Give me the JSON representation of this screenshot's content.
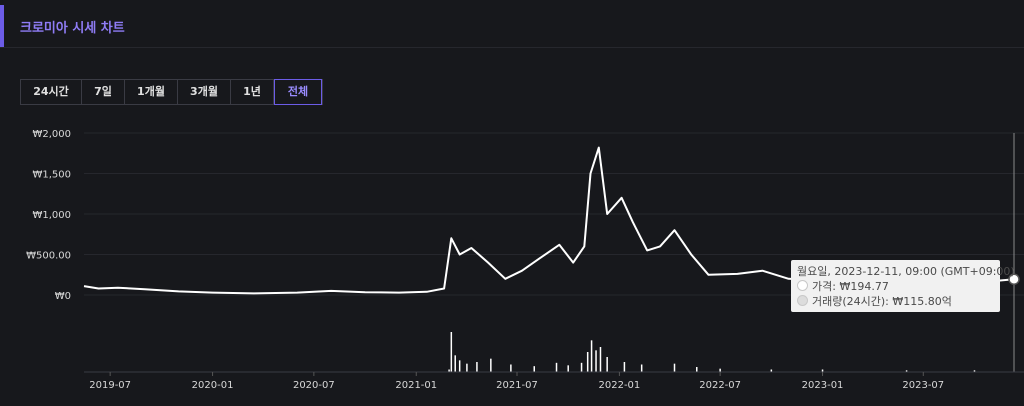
{
  "header": {
    "title": "크로미아 시세 차트"
  },
  "range_tabs": [
    {
      "label": "24시간",
      "active": false
    },
    {
      "label": "7일",
      "active": false
    },
    {
      "label": "1개월",
      "active": false
    },
    {
      "label": "3개월",
      "active": false
    },
    {
      "label": "1년",
      "active": false
    },
    {
      "label": "전체",
      "active": true
    }
  ],
  "tooltip": {
    "date": "월요일, 2023-12-11, 09:00 (GMT+09:00)",
    "price_label": "가격:",
    "price_value": "₩194.77",
    "volume_label": "거래량(24시간):",
    "volume_value": "₩115.80억"
  },
  "colors": {
    "accent": "#6c5ce7",
    "line": "#ffffff",
    "background": "#17181c"
  },
  "chart_data": {
    "type": "line",
    "title": "",
    "xlabel": "",
    "ylabel": "",
    "y_tick_labels": [
      "₩0",
      "₩500.00",
      "₩1,000",
      "₩1,500",
      "₩2,000"
    ],
    "y_tick_values": [
      0,
      500,
      1000,
      1500,
      2000
    ],
    "ylim": [
      0,
      2000
    ],
    "x_tick_labels": [
      "2019-07",
      "2020-01",
      "2020-07",
      "2021-01",
      "2021-07",
      "2022-01",
      "2022-07",
      "2023-01",
      "2023-07"
    ],
    "xlim": [
      "2019-05-15",
      "2023-12-11"
    ],
    "grid": "horizontal",
    "series": [
      {
        "values": [
          [
            "2019-05-15",
            110
          ],
          [
            "2019-06-10",
            80
          ],
          [
            "2019-07-15",
            90
          ],
          [
            "2019-09-01",
            70
          ],
          [
            "2019-11-01",
            45
          ],
          [
            "2020-01-01",
            30
          ],
          [
            "2020-03-15",
            20
          ],
          [
            "2020-06-01",
            30
          ],
          [
            "2020-08-01",
            50
          ],
          [
            "2020-10-01",
            35
          ],
          [
            "2020-12-01",
            30
          ],
          [
            "2021-01-20",
            40
          ],
          [
            "2021-02-20",
            80
          ],
          [
            "2021-03-05",
            700
          ],
          [
            "2021-03-20",
            500
          ],
          [
            "2021-04-10",
            580
          ],
          [
            "2021-05-10",
            400
          ],
          [
            "2021-06-10",
            200
          ],
          [
            "2021-07-10",
            300
          ],
          [
            "2021-08-10",
            450
          ],
          [
            "2021-09-15",
            620
          ],
          [
            "2021-10-10",
            400
          ],
          [
            "2021-10-30",
            600
          ],
          [
            "2021-11-10",
            1500
          ],
          [
            "2021-11-25",
            1820
          ],
          [
            "2021-12-10",
            1000
          ],
          [
            "2022-01-05",
            1200
          ],
          [
            "2022-01-25",
            900
          ],
          [
            "2022-02-20",
            550
          ],
          [
            "2022-03-15",
            600
          ],
          [
            "2022-04-10",
            800
          ],
          [
            "2022-05-10",
            500
          ],
          [
            "2022-06-10",
            250
          ],
          [
            "2022-08-01",
            260
          ],
          [
            "2022-09-15",
            300
          ],
          [
            "2022-11-01",
            200
          ],
          [
            "2023-01-01",
            180
          ],
          [
            "2023-03-01",
            190
          ],
          [
            "2023-05-01",
            180
          ],
          [
            "2023-07-01",
            170
          ],
          [
            "2023-09-01",
            170
          ],
          [
            "2023-11-01",
            170
          ],
          [
            "2023-12-11",
            195
          ]
        ]
      }
    ],
    "volume_series": {
      "values": [
        [
          "2021-03-01",
          3
        ],
        [
          "2021-03-05",
          48
        ],
        [
          "2021-03-12",
          20
        ],
        [
          "2021-03-20",
          14
        ],
        [
          "2021-04-02",
          10
        ],
        [
          "2021-04-20",
          12
        ],
        [
          "2021-05-15",
          16
        ],
        [
          "2021-06-20",
          9
        ],
        [
          "2021-08-01",
          7
        ],
        [
          "2021-09-10",
          11
        ],
        [
          "2021-10-01",
          8
        ],
        [
          "2021-10-25",
          11
        ],
        [
          "2021-11-05",
          24
        ],
        [
          "2021-11-12",
          38
        ],
        [
          "2021-11-20",
          26
        ],
        [
          "2021-11-28",
          30
        ],
        [
          "2021-12-10",
          18
        ],
        [
          "2022-01-10",
          12
        ],
        [
          "2022-02-10",
          9
        ],
        [
          "2022-04-10",
          10
        ],
        [
          "2022-05-20",
          6
        ],
        [
          "2022-07-01",
          4
        ],
        [
          "2022-10-01",
          3
        ],
        [
          "2023-01-01",
          3
        ],
        [
          "2023-06-01",
          2
        ],
        [
          "2023-10-01",
          2
        ]
      ]
    }
  }
}
